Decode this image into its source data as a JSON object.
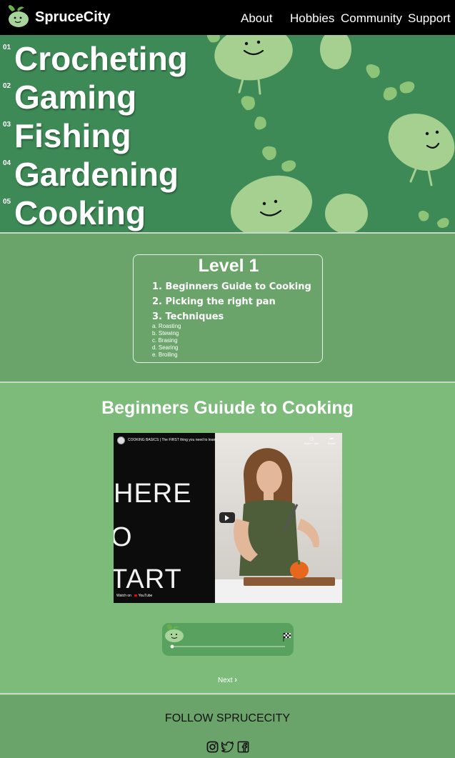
{
  "nav": {
    "brand": "SpruceCity",
    "links": [
      "About",
      "Hobbies",
      "Community",
      "Support"
    ]
  },
  "hero": {
    "hobbies": [
      {
        "num": "01",
        "name": "Crocheting"
      },
      {
        "num": "02",
        "name": "Gaming"
      },
      {
        "num": "03",
        "name": "Fishing"
      },
      {
        "num": "04",
        "name": "Gardening"
      },
      {
        "num": "05",
        "name": "Cooking"
      }
    ]
  },
  "level": {
    "title": "Level 1",
    "items": [
      "1. Beginners Guide to Cooking",
      "2. Picking the right pan",
      "3. Techniques"
    ],
    "subitems": [
      "a. Roasting",
      "b. Stewing",
      "c. Brasing",
      "d. Searing",
      "e. Broiling"
    ]
  },
  "guide": {
    "title": "Beginners Guiude to Cooking",
    "video": {
      "title": "COOKING BASICS | The FIRST thing you need to learn",
      "watch_later": "Watch Later",
      "share": "Share",
      "overlay_lines": [
        "HERE",
        "O",
        "TART"
      ],
      "watch_on": "Watch on",
      "platform": "YouTube"
    },
    "progress": 0.0,
    "next_label": "Next"
  },
  "footer": {
    "follow": "FOLLOW SPRUCECITY",
    "social": [
      "instagram-icon",
      "twitter-icon",
      "facebook-icon"
    ]
  },
  "colors": {
    "nav_bg": "#000000",
    "hero_bg": "#3d8a56",
    "level_bg": "#6aa46a",
    "guide_bg": "#7dbb7b",
    "footer_bg": "#6aa46a",
    "progress_bg": "#58a15f"
  }
}
